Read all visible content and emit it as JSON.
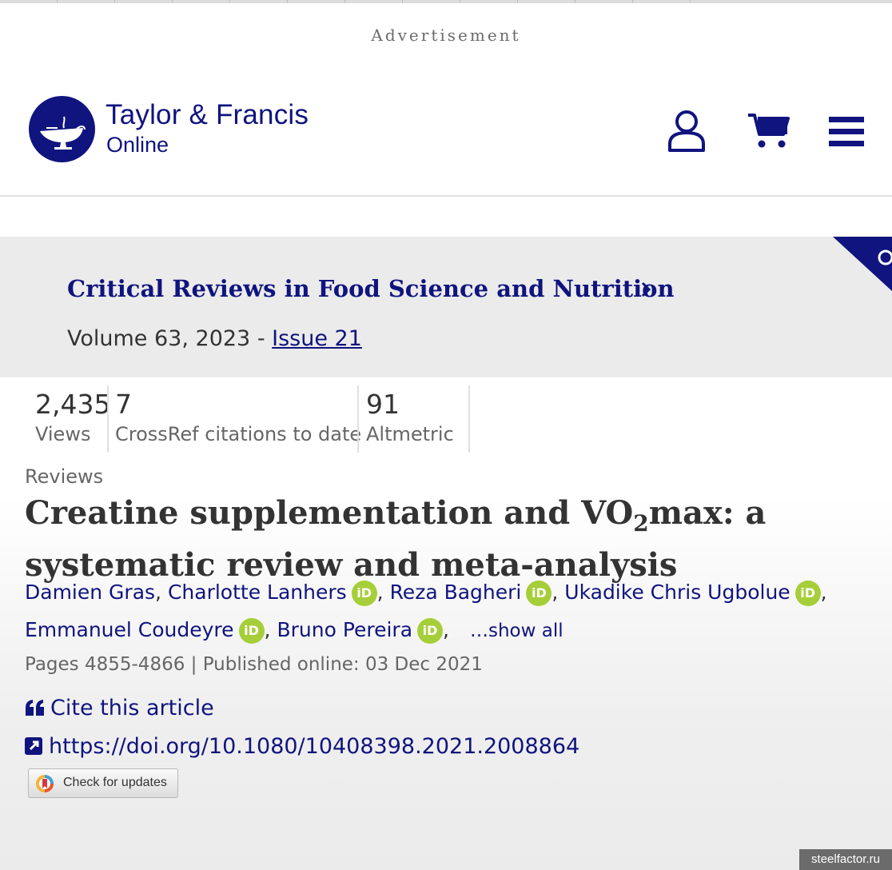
{
  "advertisement": "Advertisement",
  "brand": {
    "name_line1": "Taylor & Francis",
    "name_line2": "Online",
    "color": "#10147e"
  },
  "header_icons": [
    "user-icon",
    "cart-icon",
    "menu-icon"
  ],
  "journal": {
    "title": "Critical Reviews in Food Science and Nutrition",
    "volume_text": "Volume 63, 2023 - ",
    "issue_link": "Issue 21"
  },
  "metrics": [
    {
      "value": "2,435",
      "label": "Views"
    },
    {
      "value": "7",
      "label": "CrossRef citations to date"
    },
    {
      "value": "91",
      "label": "Altmetric"
    }
  ],
  "article": {
    "section": "Reviews",
    "title_part1": "Creatine supplementation and VO",
    "title_sub": "2",
    "title_part2": "max: a systematic review and meta-analysis",
    "authors_line1": [
      "Damien Gras",
      "Charlotte Lanhers",
      "Reza Bagheri",
      "Ukadike Chris Ugbolue"
    ],
    "authors_line2": [
      "Emmanuel Coudeyre",
      "Bruno Pereira"
    ],
    "orcid_label": "iD",
    "show_all": "…show all",
    "pages": "Pages 4855-4866",
    "published": "Published online: 03 Dec 2021",
    "cite_label": "Cite this article",
    "doi": "https://doi.org/10.1080/10408398.2021.2008864",
    "check_updates": "Check for updates"
  },
  "watermark": "steelfactor.ru",
  "colors": {
    "accent": "#10147e",
    "orcid": "#a6ce39",
    "band": "#ebebeb"
  }
}
